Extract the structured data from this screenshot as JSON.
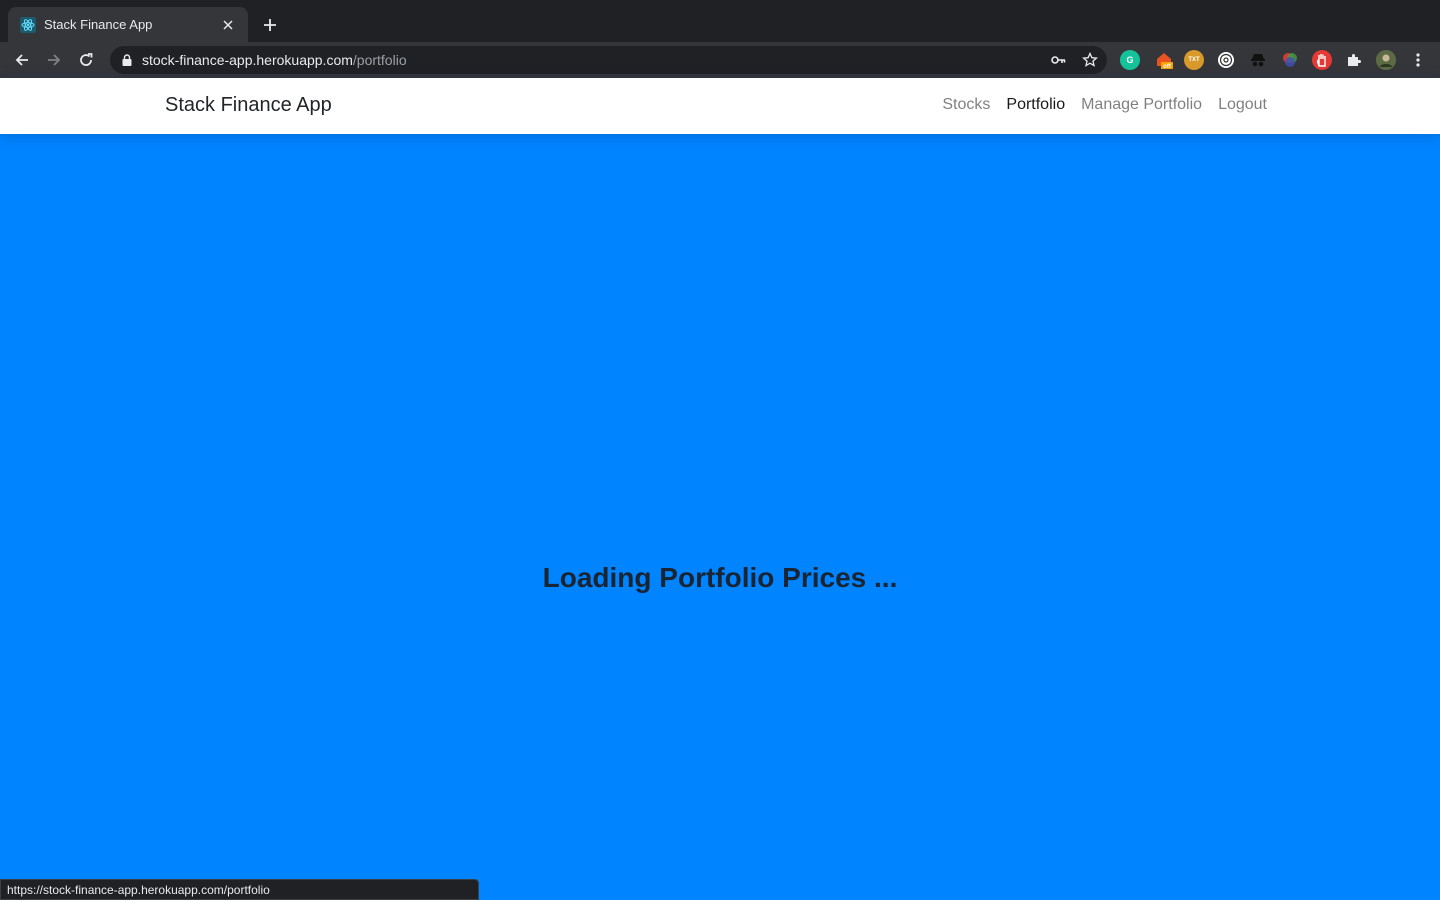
{
  "browser": {
    "tab": {
      "title": "Stack Finance App",
      "favicon": "react-logo-icon"
    },
    "omnibox": {
      "host": "stock-finance-app.herokuapp.com",
      "path": "/portfolio"
    },
    "status_url": "https://stock-finance-app.herokuapp.com/portfolio",
    "extensions": [
      {
        "name": "grammarly-extension-icon",
        "color": "#15c39a",
        "glyph": "G"
      },
      {
        "name": "off-extension-icon",
        "color": "#e8531f",
        "glyph": "off"
      },
      {
        "name": "txt-extension-icon",
        "color": "#d99a2b",
        "glyph": "TXT"
      },
      {
        "name": "circle-extension-icon",
        "color": "#ffffff",
        "glyph": ""
      },
      {
        "name": "incognito-extension-icon",
        "color": "#1a1a1a",
        "glyph": ""
      },
      {
        "name": "color-wheel-extension-icon",
        "color": "#7a4fe0",
        "glyph": ""
      },
      {
        "name": "hand-extension-icon",
        "color": "#e53935",
        "glyph": ""
      }
    ]
  },
  "navbar": {
    "brand": "Stack Finance App",
    "links": [
      {
        "label": "Stocks",
        "active": false
      },
      {
        "label": "Portfolio",
        "active": true
      },
      {
        "label": "Manage Portfolio",
        "active": false
      },
      {
        "label": "Logout",
        "active": false
      }
    ]
  },
  "main": {
    "loading_text": "Loading Portfolio Prices ..."
  },
  "colors": {
    "page_bg": "#0084ff",
    "navbar_bg": "#ffffff",
    "heading": "#1a2533"
  }
}
